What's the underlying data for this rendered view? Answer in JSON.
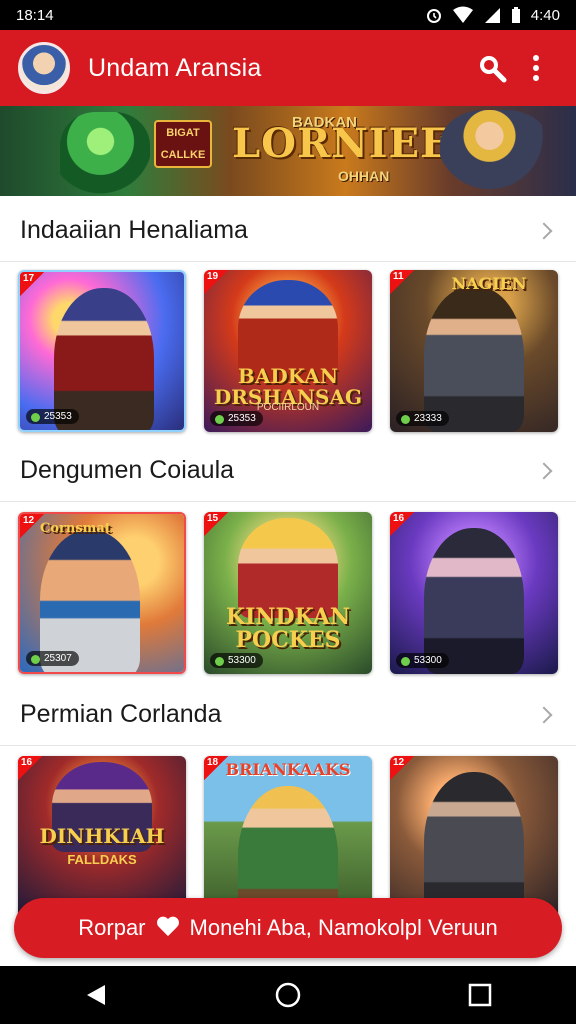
{
  "status": {
    "time": "18:14",
    "battery_text": "4:40"
  },
  "app": {
    "title": "Undam Aransia"
  },
  "banner": {
    "title": "LORNIEE",
    "top_text": "BADKAN",
    "sub_text": "OHHAN",
    "badge_text": "BIGAT CALLKE"
  },
  "sections": [
    {
      "title": "Indaaiian Henaliama",
      "cards": [
        {
          "corner": "17",
          "count": "25353",
          "art_title": "",
          "art_sub": "",
          "palette": "violet"
        },
        {
          "corner": "19",
          "count": "25353",
          "art_title": "BADKAN DRSHANSAG",
          "art_sub": "POCIIRLOUN",
          "palette": "fire"
        },
        {
          "corner": "11",
          "count": "23333",
          "art_title": "NAGIEN",
          "art_sub": "",
          "palette": "dark"
        }
      ]
    },
    {
      "title": "Dengumen Coiaula",
      "cards": [
        {
          "corner": "12",
          "count": "25307",
          "art_title": "Cornsmat",
          "art_sub": "",
          "palette": "sunset"
        },
        {
          "corner": "15",
          "count": "53300",
          "art_title": "KINDKAN POCKES",
          "art_sub": "",
          "palette": "forest"
        },
        {
          "corner": "16",
          "count": "53300",
          "art_title": "",
          "art_sub": "",
          "palette": "purple"
        }
      ]
    },
    {
      "title": "Permian Corlanda",
      "cards": [
        {
          "corner": "16",
          "count": "",
          "art_title": "DINHKIAH",
          "art_sub": "FALLDAKS",
          "palette": "ember"
        },
        {
          "corner": "18",
          "count": "",
          "art_title": "BRIANKAAKS",
          "art_sub": "",
          "palette": "jungle"
        },
        {
          "corner": "12",
          "count": "",
          "art_title": "",
          "art_sub": "",
          "palette": "ruins"
        }
      ]
    }
  ],
  "cta": {
    "left_text": "Rorpar",
    "right_text": "Monehi Aba, Namokolpl Veruun"
  },
  "icons": {
    "search": "search-icon",
    "more": "more-vert-icon",
    "heart": "heart-icon",
    "back": "back-icon",
    "home": "home-icon",
    "recents": "recents-icon"
  },
  "colors": {
    "primary": "#d71a21",
    "status_bar": "#000000"
  }
}
